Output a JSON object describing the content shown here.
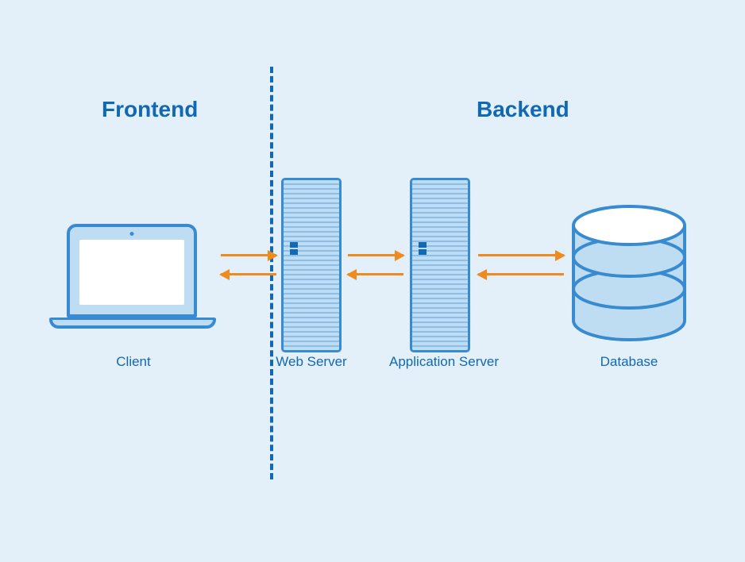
{
  "sections": {
    "frontend": "Frontend",
    "backend": "Backend"
  },
  "nodes": {
    "client": "Client",
    "web_server": "Web Server",
    "app_server": "Application Server",
    "database": "Database"
  }
}
